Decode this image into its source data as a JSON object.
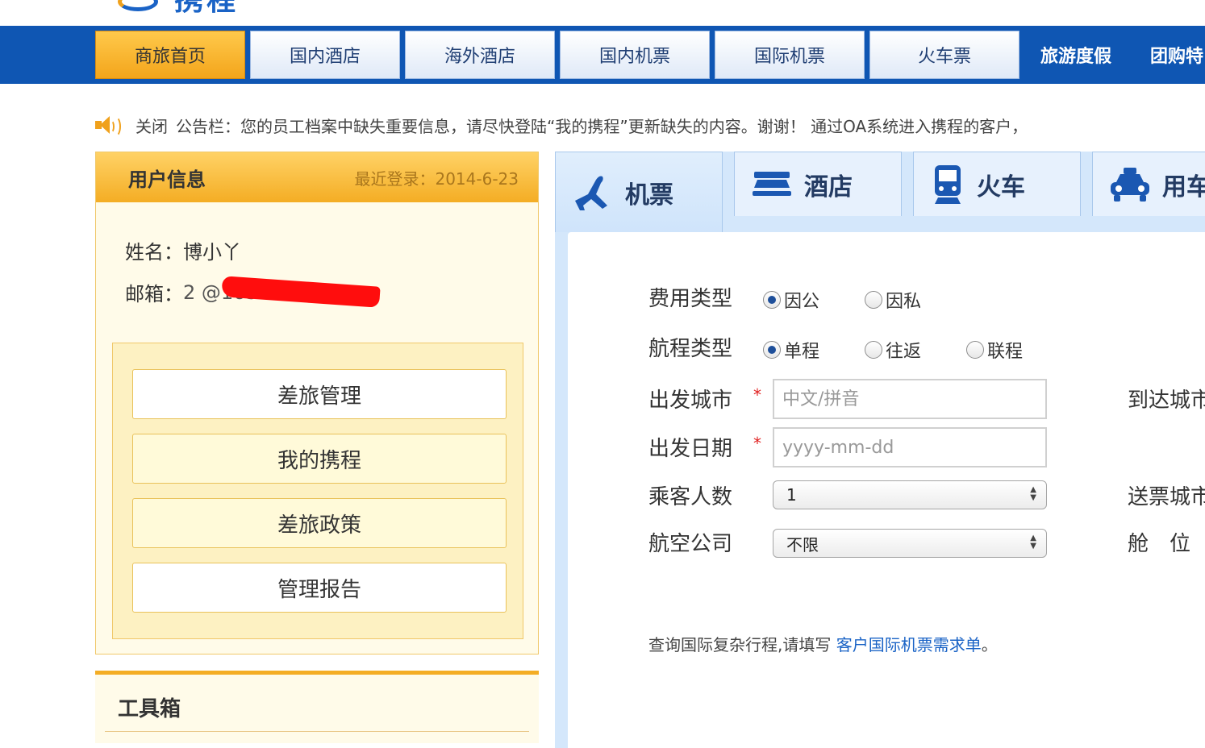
{
  "logo": {
    "text": "携程"
  },
  "nav": {
    "tabs": [
      "商旅首页",
      "国内酒店",
      "海外酒店",
      "国内机票",
      "国际机票",
      "火车票"
    ],
    "active_index": 0,
    "links": [
      "旅游度假",
      "团购特"
    ]
  },
  "announcement": {
    "close_label": "关闭",
    "text": "公告栏：您的员工档案中缺失重要信息，请尽快登陆“我的携程”更新缺失的内容。谢谢！ 通过OA系统进入携程的客户，"
  },
  "user_info": {
    "title": "用户信息",
    "last_login": "最近登录：2014-6-23",
    "name_label": "姓名：",
    "name_value": "博小丫",
    "email_label": "邮箱：",
    "email_value": "2          @163.com",
    "menu": [
      "差旅管理",
      "我的携程",
      "差旅政策",
      "管理报告"
    ]
  },
  "toolbox": {
    "title": "工具箱"
  },
  "booking": {
    "tabs": [
      {
        "label": "机票",
        "icon": "plane-icon"
      },
      {
        "label": "酒店",
        "icon": "bed-icon"
      },
      {
        "label": "火车",
        "icon": "train-icon"
      },
      {
        "label": "用车",
        "icon": "car-icon"
      }
    ],
    "active_tab": 0,
    "form": {
      "expense_type_label": "费用类型",
      "expense_options": [
        "因公",
        "因私"
      ],
      "expense_selected": "因公",
      "trip_type_label": "航程类型",
      "trip_options": [
        "单程",
        "往返",
        "联程"
      ],
      "trip_selected": "单程",
      "depart_city_label": "出发城市",
      "depart_city_placeholder": "中文/拼音",
      "depart_date_label": "出发日期",
      "depart_date_placeholder": "yyyy-mm-dd",
      "passengers_label": "乘客人数",
      "passengers_value": "1",
      "airline_label": "航空公司",
      "airline_value": "不限",
      "arrive_city_label": "到达城市",
      "delivery_city_label": "送票城市",
      "cabin_label": "舱　位",
      "required_mark": "*"
    },
    "note": {
      "text": "查询国际复杂行程,请填写",
      "link": "客户国际机票需求单",
      "suffix": "。"
    }
  }
}
